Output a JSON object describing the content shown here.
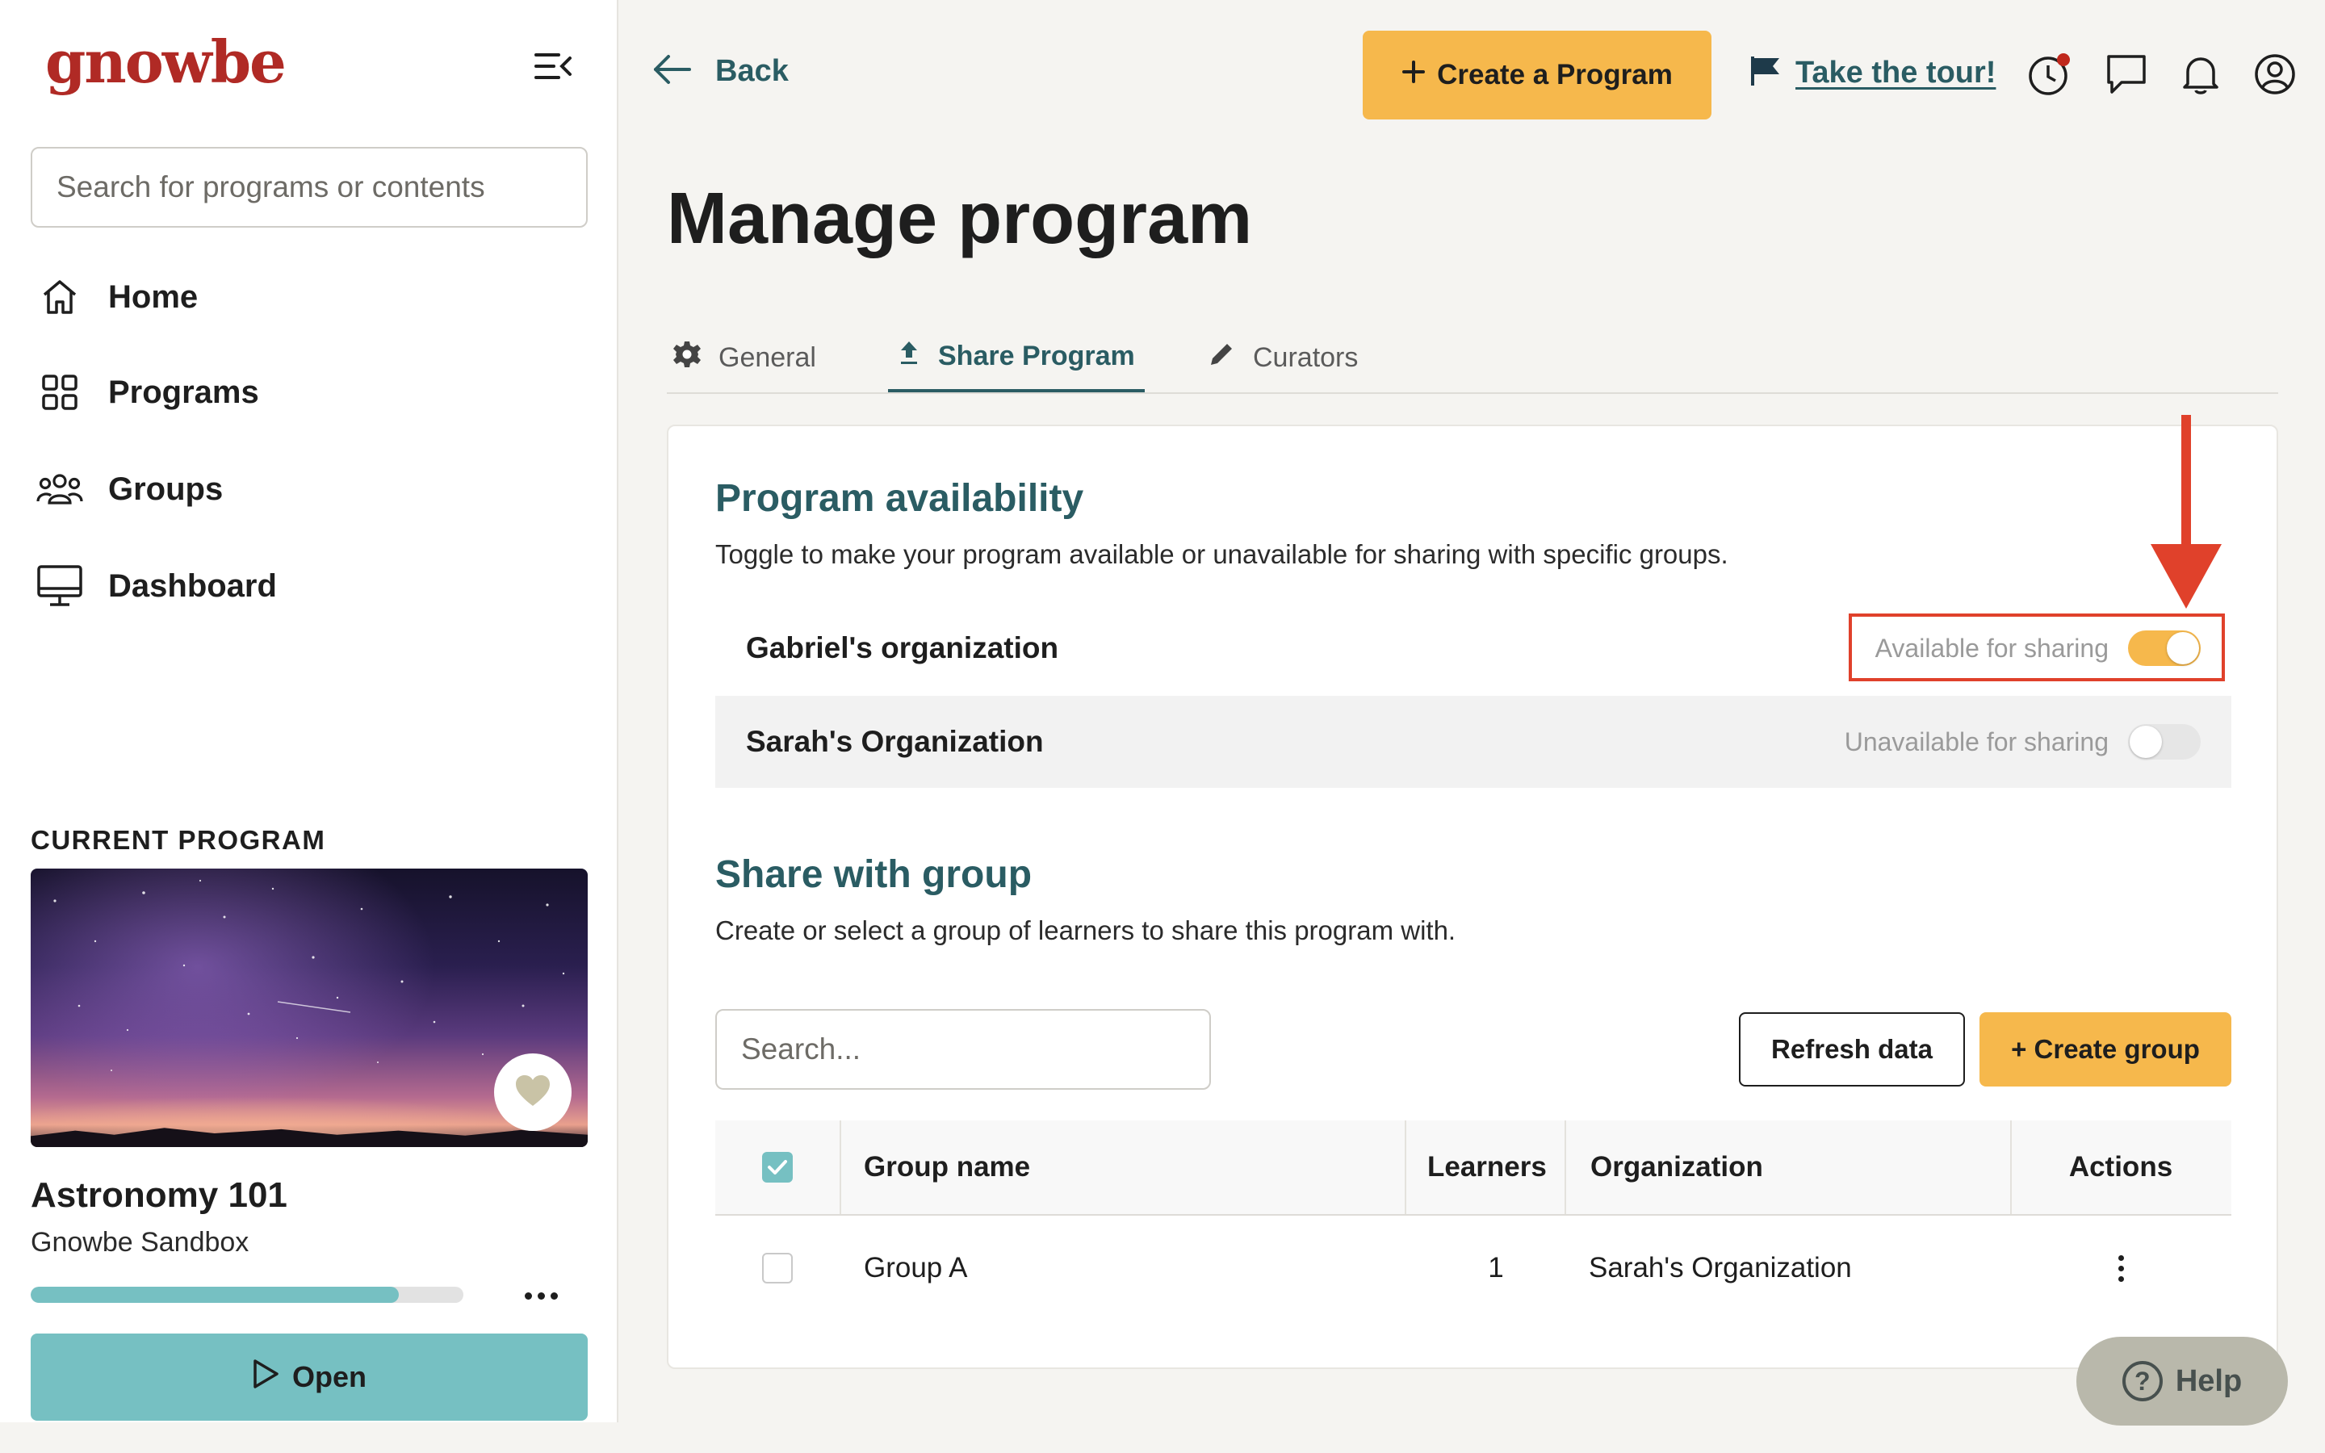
{
  "brand": {
    "logo_text": "gnowbe",
    "accent": "#b02a25",
    "primary": "#f6b84c",
    "teal": "#2a5c63",
    "light_teal": "#76c0c2"
  },
  "sidebar": {
    "search_placeholder": "Search for programs or contents",
    "nav": [
      {
        "label": "Home",
        "icon": "home-icon"
      },
      {
        "label": "Programs",
        "icon": "grid-icon"
      },
      {
        "label": "Groups",
        "icon": "users-icon"
      },
      {
        "label": "Dashboard",
        "icon": "monitor-icon"
      }
    ],
    "current_program": {
      "heading": "CURRENT PROGRAM",
      "title": "Astronomy 101",
      "subtitle": "Gnowbe Sandbox",
      "progress": 0.85,
      "open_label": "Open"
    }
  },
  "topbar": {
    "back_label": "Back",
    "create_program_label": "Create a Program",
    "tour_label": "Take the tour!",
    "icons": [
      "clock-icon",
      "chat-icon",
      "bell-icon",
      "user-circle-icon"
    ]
  },
  "page": {
    "title": "Manage program",
    "tabs": [
      {
        "label": "General",
        "icon": "gear-icon",
        "active": false
      },
      {
        "label": "Share Program",
        "icon": "upload-icon",
        "active": true
      },
      {
        "label": "Curators",
        "icon": "pencil-icon",
        "active": false
      }
    ]
  },
  "availability": {
    "title": "Program availability",
    "description": "Toggle to make your program available or unavailable for sharing with specific groups.",
    "orgs": [
      {
        "name": "Gabriel's organization",
        "status": "Available for sharing",
        "on": true
      },
      {
        "name": "Sarah's Organization",
        "status": "Unavailable for sharing",
        "on": false
      }
    ]
  },
  "share": {
    "title": "Share with group",
    "description": "Create or select a group of learners to share this program with.",
    "search_placeholder": "Search...",
    "refresh_label": "Refresh data",
    "create_group_label": "+ Create group",
    "table": {
      "columns": [
        "Group name",
        "Learners",
        "Organization",
        "Actions"
      ],
      "rows": [
        {
          "group_name": "Group A",
          "learners": "1",
          "organization": "Sarah's Organization"
        }
      ]
    }
  },
  "help": {
    "label": "Help"
  }
}
